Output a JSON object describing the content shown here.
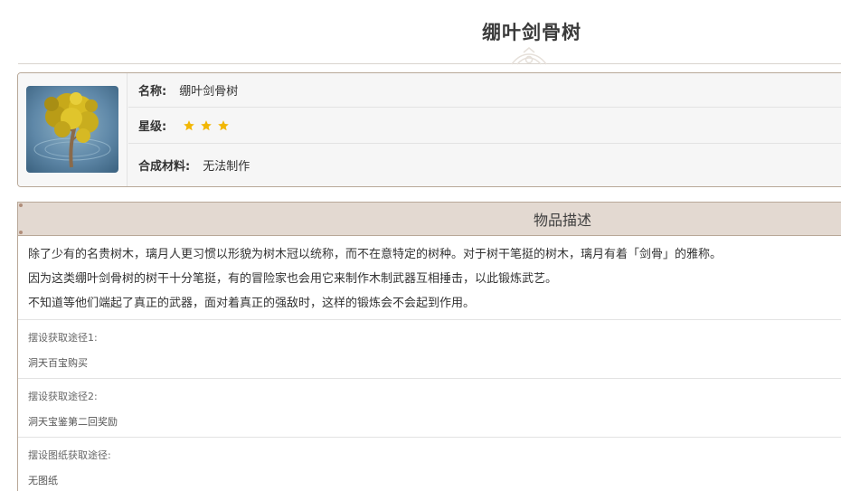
{
  "page": {
    "title": "绷叶剑骨树"
  },
  "info": {
    "name_label": "名称:",
    "name_value": "绷叶剑骨树",
    "rarity_label": "星级:",
    "rarity_stars": 3,
    "material_label": "合成材料:",
    "material_value": "无法制作"
  },
  "description": {
    "header": "物品描述",
    "lines": [
      "除了少有的名贵树木，璃月人更习惯以形貌为树木冠以统称，而不在意特定的树种。对于树干笔挺的树木，璃月有着「剑骨」的雅称。",
      "因为这类绷叶剑骨树的树干十分笔挺，有的冒险家也会用它来制作木制武器互相捶击，以此锻炼武艺。",
      "不知道等他们端起了真正的武器，面对着真正的强敌时，这样的锻炼会不会起到作用。"
    ]
  },
  "sources": [
    {
      "label": "摆设获取途径1:",
      "value": "洞天百宝购买"
    },
    {
      "label": "摆设获取途径2:",
      "value": "洞天宝鉴第二回奖励"
    },
    {
      "label": "摆设图纸获取途径:",
      "value": "无图纸"
    }
  ],
  "colors": {
    "star": "#f2b705",
    "border": "#b8a898",
    "header_bg": "#e3d9d1"
  }
}
